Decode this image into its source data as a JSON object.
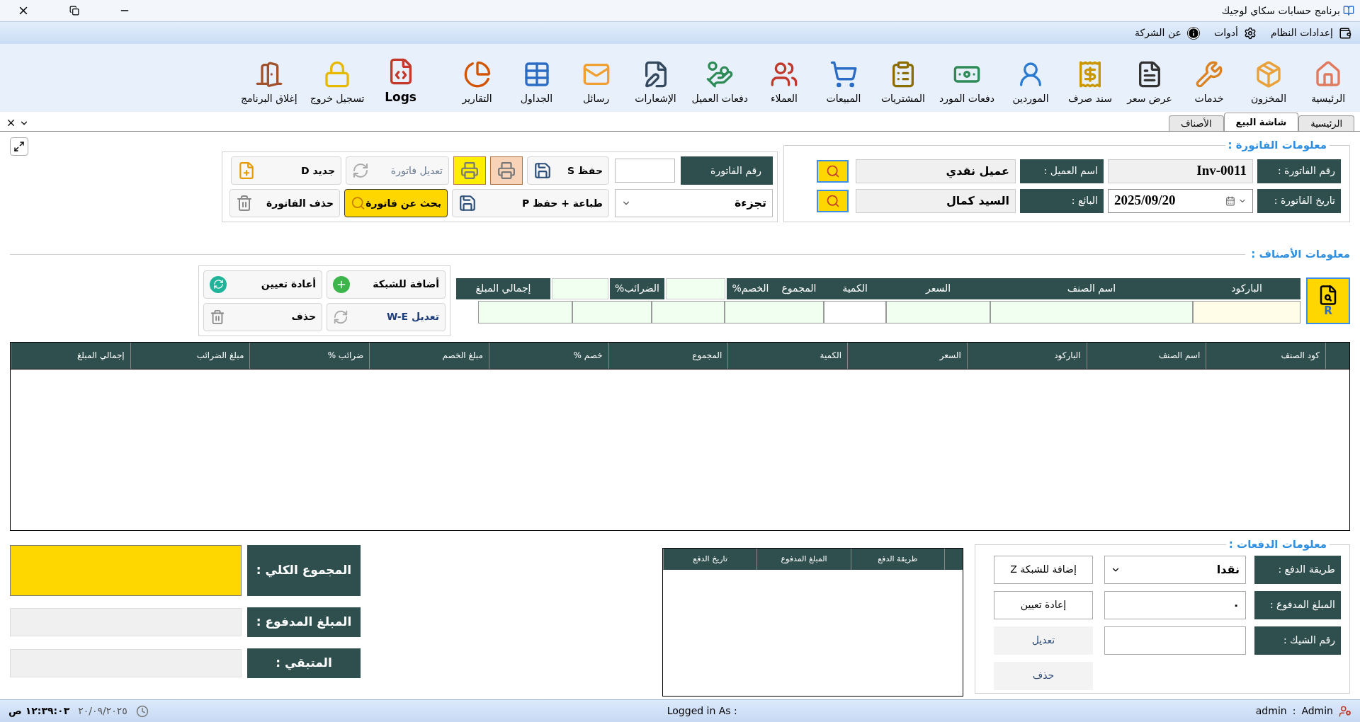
{
  "window": {
    "title": "برنامج حسابات سكاي لوجيك"
  },
  "menu": [
    {
      "label": "إعدادات النظام"
    },
    {
      "label": "أدوات"
    },
    {
      "label": "عن الشركة"
    }
  ],
  "toolbar": [
    {
      "label": "الرئيسية"
    },
    {
      "label": "المخزون"
    },
    {
      "label": "خدمات"
    },
    {
      "label": "عرض سعر"
    },
    {
      "label": "سند صرف"
    },
    {
      "label": "الموردين"
    },
    {
      "label": "دفعات المورد"
    },
    {
      "label": "المشتريات"
    },
    {
      "label": "المبيعات"
    },
    {
      "label": "العملاء"
    },
    {
      "label": "دفعات العميل"
    },
    {
      "label": "الإشعارات"
    },
    {
      "label": "رسائل"
    },
    {
      "label": "الجداول"
    },
    {
      "label": "التقارير"
    },
    {
      "label": "Logs"
    },
    {
      "label": "تسجيل خروج"
    },
    {
      "label": "إغلاق البرنامج"
    }
  ],
  "tabs": [
    {
      "label": "الرئيسية",
      "selected": false
    },
    {
      "label": "شاشة البيع",
      "selected": true
    },
    {
      "label": "الأصناف",
      "selected": false
    }
  ],
  "invoice_info": {
    "title": "معلومات الفاتورة :",
    "rows": [
      [
        {
          "kind": "text",
          "label": "رقم الفاتورة :",
          "value": "Inv-0011"
        },
        {
          "kind": "lookup",
          "label": "اسم العميل :",
          "value": "عميل نقدي"
        }
      ],
      [
        {
          "kind": "date",
          "label": "تاريخ الفاتورة :",
          "value": "2025/09/20"
        },
        {
          "kind": "lookup",
          "label": "البائع :",
          "value": "السيد كمال"
        }
      ]
    ]
  },
  "invoice_actions": {
    "search_label": "رقم الفاتورة",
    "sale_type": "تجزءة",
    "rows": [
      [
        {
          "kind": "save",
          "label": "حفظ S",
          "disabled": false
        },
        {
          "kind": "print",
          "color": "#f8d3b8",
          "disabled": false
        },
        {
          "kind": "print",
          "color": "#ffee00",
          "disabled": false
        },
        {
          "kind": "edit",
          "label": "تعديل فاتورة",
          "disabled": true
        },
        {
          "kind": "new",
          "label": "جديد D",
          "disabled": false
        }
      ],
      [
        {
          "kind": "save_print",
          "label": "طباعة + حفظ P",
          "disabled": false
        },
        {
          "kind": "search",
          "label": "بحث عن فاتورة",
          "disabled": false
        },
        {
          "kind": "delete",
          "label": "حذف الفاتورة",
          "disabled": false
        }
      ]
    ]
  },
  "items": {
    "title": "معلومات الأصناف :",
    "search_key": "R",
    "header": [
      {
        "kind": "label",
        "label": "الباركود"
      },
      {
        "kind": "label",
        "label": "اسم الصنف"
      },
      {
        "kind": "label",
        "label": "السعر"
      },
      {
        "kind": "label",
        "label": "الكمية"
      },
      {
        "kind": "label",
        "label": "المجموع"
      },
      {
        "kind": "label",
        "label": "الخصم%"
      },
      {
        "kind": "input"
      },
      {
        "kind": "label",
        "label": "الضرائب%"
      },
      {
        "kind": "input"
      },
      {
        "kind": "label",
        "label": "إجمالي المبلغ"
      }
    ],
    "buttons": [
      {
        "kind": "add",
        "label": "أضافة للشبكة",
        "disabled": false
      },
      {
        "kind": "reset",
        "label": "أعادة تعيين",
        "disabled": false
      },
      {
        "kind": "edit",
        "label": "تعديل W-E",
        "disabled": false
      },
      {
        "kind": "delete",
        "label": "حذف",
        "disabled": false
      }
    ]
  },
  "table": {
    "columns": [
      "كود الصنف",
      "اسم الصنف",
      "الباركود",
      "السعر",
      "الكمية",
      "المجموع",
      "خصم %",
      "مبلغ الخصم",
      "ضرائب %",
      "مبلغ الضرائب",
      "إجمالي المبلغ"
    ]
  },
  "payments": {
    "title": "معلومات الدفعات :",
    "fields": [
      {
        "kind": "select",
        "label": "طريقة الدفع :",
        "value": "نقدا"
      },
      {
        "kind": "input",
        "label": "المبلغ المدفوع :",
        "value": "٠"
      },
      {
        "kind": "input",
        "label": "رقم الشيك :"
      }
    ],
    "buttons": [
      {
        "label": "إضافة للشبكة Z",
        "disabled": false
      },
      {
        "label": "إعادة تعيين",
        "disabled": false
      },
      {
        "label": "تعديل",
        "disabled": true
      },
      {
        "label": "حذف",
        "disabled": true
      }
    ],
    "table_columns": [
      "طريقة الدفع",
      "المبلغ المدفوع",
      "تاريخ الدفع"
    ]
  },
  "totals": [
    {
      "label": "المجموع الكلي :",
      "highlight": true
    },
    {
      "label": "المبلغ المدفوع :",
      "highlight": false
    },
    {
      "label": "المتبقي :",
      "highlight": false
    }
  ],
  "status_bar": {
    "user_role": "Admin",
    "separator": ":",
    "user_name": "admin",
    "logged_in": "Logged in As :",
    "date": "٢٠/٠٩/٢٠٢٥",
    "time": "١٢:٣٩:٠٣ ص"
  }
}
